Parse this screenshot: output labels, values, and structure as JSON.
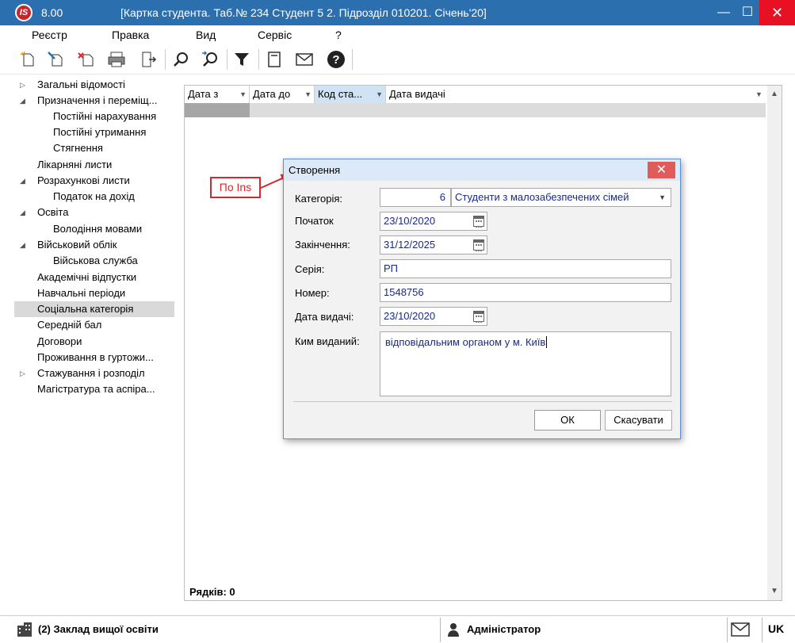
{
  "window": {
    "logo": "IS",
    "version": "8.00",
    "title": "[Картка студента. Таб.№ 234 Студент 5 2. Підрозділ 010201. Січень'20]",
    "min_label": "—",
    "max_label": "☐",
    "close_label": "✕"
  },
  "menu": [
    "Реєстр",
    "Правка",
    "Вид",
    "Сервіс",
    "?"
  ],
  "toolbar": {
    "icons": [
      "new-doc-icon",
      "edit-doc-icon",
      "delete-doc-icon",
      "print-icon",
      "exit-icon",
      "search-icon",
      "find-next-icon",
      "filter-icon",
      "form-icon",
      "mail-icon",
      "help-icon"
    ]
  },
  "tree": [
    {
      "label": "Загальні відомості",
      "level": 0,
      "arrow": "collapsed"
    },
    {
      "label": "Призначення і переміщ...",
      "level": 0,
      "arrow": "expanded"
    },
    {
      "label": "Постійні нарахування",
      "level": 1
    },
    {
      "label": "Постійні утримання",
      "level": 1
    },
    {
      "label": "Стягнення",
      "level": 1
    },
    {
      "label": "Лікарняні листи",
      "level": 0
    },
    {
      "label": "Розрахункові листи",
      "level": 0,
      "arrow": "expanded"
    },
    {
      "label": "Податок на дохід",
      "level": 1
    },
    {
      "label": "Освіта",
      "level": 0,
      "arrow": "expanded"
    },
    {
      "label": "Володіння мовами",
      "level": 1
    },
    {
      "label": "Військовий облік",
      "level": 0,
      "arrow": "expanded"
    },
    {
      "label": "Військова служба",
      "level": 1
    },
    {
      "label": "Академічні відпустки",
      "level": 0
    },
    {
      "label": "Навчальні періоди",
      "level": 0
    },
    {
      "label": "Соціальна категорія",
      "level": 0,
      "selected": true
    },
    {
      "label": "Середній бал",
      "level": 0
    },
    {
      "label": "Договори",
      "level": 0
    },
    {
      "label": "Проживання в гуртожи...",
      "level": 0
    },
    {
      "label": "Стажування і розподіл",
      "level": 0,
      "arrow": "collapsed"
    },
    {
      "label": "Магістратура та аспіра...",
      "level": 0
    }
  ],
  "grid": {
    "columns": [
      "Дата з",
      "Дата до",
      "Код ста...",
      "Дата видачі"
    ],
    "footer": "Рядків: 0"
  },
  "dialog": {
    "title": "Створення",
    "labels": {
      "category": "Категорія:",
      "start": "Початок",
      "end": "Закінчення:",
      "series": "Серія:",
      "number": "Номер:",
      "issue_date": "Дата видачі:",
      "issued_by": "Ким виданий:"
    },
    "values": {
      "category_code": "6",
      "category_name": "Студенти з малозабезпечених сімей",
      "start": "23/10/2020",
      "end": "31/12/2025",
      "series": "РП",
      "number": "1548756",
      "issue_date": "23/10/2020",
      "issued_by": "відповідальним органом у м. Київ"
    },
    "ok_label": "ОК",
    "cancel_label": "Скасувати"
  },
  "annotation": {
    "text": "По Ins",
    "color": "#d9262c"
  },
  "status": {
    "org": "(2) Заклад вищої освіти",
    "user": "Адміністратор",
    "lang": "UK"
  },
  "colors": {
    "titlebar": "#2b6fae",
    "close": "#e81123",
    "selection": "#d9d9d9",
    "field_text": "#1a2a8a"
  }
}
